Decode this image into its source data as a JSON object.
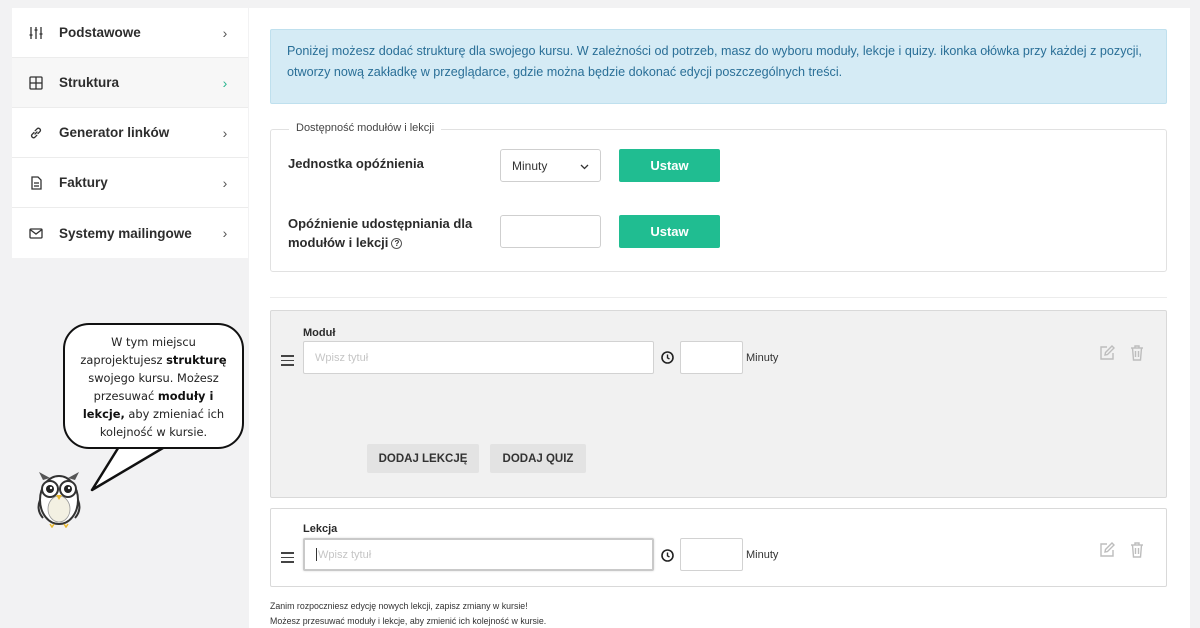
{
  "sidebar": {
    "items": [
      {
        "label": "Podstawowe",
        "icon": "sliders-icon",
        "active": false
      },
      {
        "label": "Struktura",
        "icon": "grid-icon",
        "active": true
      },
      {
        "label": "Generator linków",
        "icon": "link-icon",
        "active": false
      },
      {
        "label": "Faktury",
        "icon": "document-icon",
        "active": false
      },
      {
        "label": "Systemy mailingowe",
        "icon": "mail-icon",
        "active": false
      }
    ]
  },
  "info": {
    "text": "Poniżej możesz dodać strukturę dla swojego kursu. W zależności od potrzeb, masz do wyboru moduły, lekcje i quizy. ikonka ołówka przy każdej z pozycji, otworzy nową zakładkę w przeglądarce, gdzie można będzie dokonać edycji poszczególnych treści."
  },
  "availability": {
    "legend": "Dostępność modułów i lekcji",
    "delay_unit_label": "Jednostka opóźnienia",
    "delay_unit_value": "Minuty",
    "set_button": "Ustaw",
    "share_delay_label_line1": "Opóźnienie udostępniania dla",
    "share_delay_label_line2": "modułów i lekcji",
    "share_delay_value": ""
  },
  "module": {
    "title": "Moduł",
    "title_placeholder": "Wpisz tytuł",
    "minutes_label": "Minuty",
    "add_lesson_button": "DODAJ LEKCJĘ",
    "add_quiz_button": "DODAJ QUIZ"
  },
  "lesson": {
    "title": "Lekcja",
    "title_placeholder": "Wpisz tytuł",
    "minutes_label": "Minuty"
  },
  "footer": {
    "line1": "Zanim rozpoczniesz edycję nowych lekcji, zapisz zmiany w kursie!",
    "line2": "Możesz przesuwać moduły i lekcje, aby zmienić ich kolejność w kursie."
  },
  "bubble": {
    "part1": "W tym miejscu zaprojektujesz",
    "bold1": "strukturę",
    "part2": "swojego kursu.  Możesz przesuwać",
    "bold2": "moduły i lekcje,",
    "part3": "aby zmieniać ich kolejność w kursie."
  },
  "colors": {
    "accent_green": "#20bd91",
    "info_bg": "#d5ebf5",
    "info_text": "#2a6f97"
  }
}
